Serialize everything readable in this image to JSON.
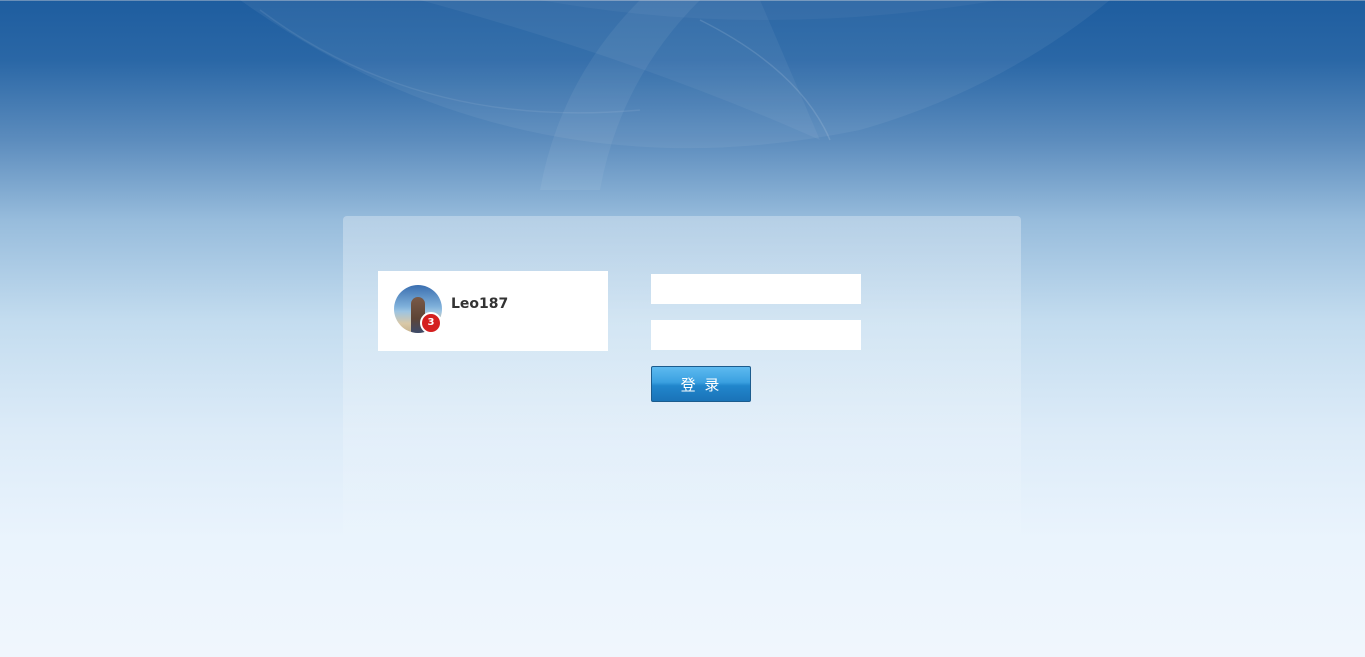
{
  "user": {
    "name": "Leo187",
    "notification_count": "3"
  },
  "form": {
    "username_value": "",
    "password_value": "",
    "login_label": "登 录"
  },
  "colors": {
    "background_top": "#1e5d9f",
    "background_bottom": "#f0f6fd",
    "button": "#2186cc",
    "badge": "#d41f1f"
  }
}
